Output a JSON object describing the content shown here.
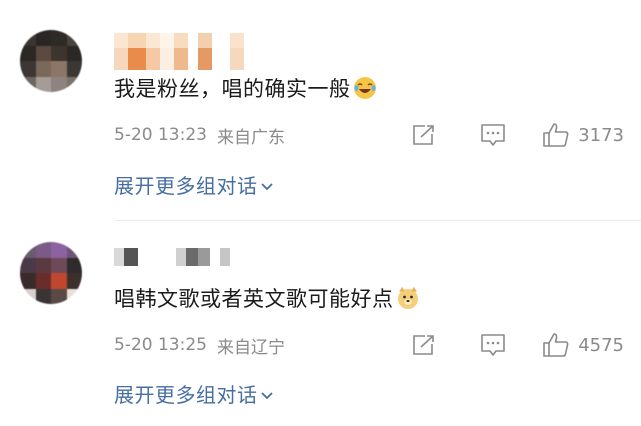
{
  "comments": [
    {
      "text": "我是粉丝，唱的确实一般",
      "emoji_icon": "laughing-crying-emoji",
      "time": "5-20 13:23",
      "location": "来自广东",
      "likes": "3173",
      "expand_label": "展开更多组对话"
    },
    {
      "text": "唱韩文歌或者英文歌可能好点",
      "emoji_icon": "doge-emoji",
      "time": "5-20 13:25",
      "location": "来自辽宁",
      "likes": "4575",
      "expand_label": "展开更多组对话"
    }
  ],
  "colors": {
    "link_blue": "#476ea3",
    "meta_gray": "#8a8a8a",
    "text": "#1b1b1b"
  }
}
